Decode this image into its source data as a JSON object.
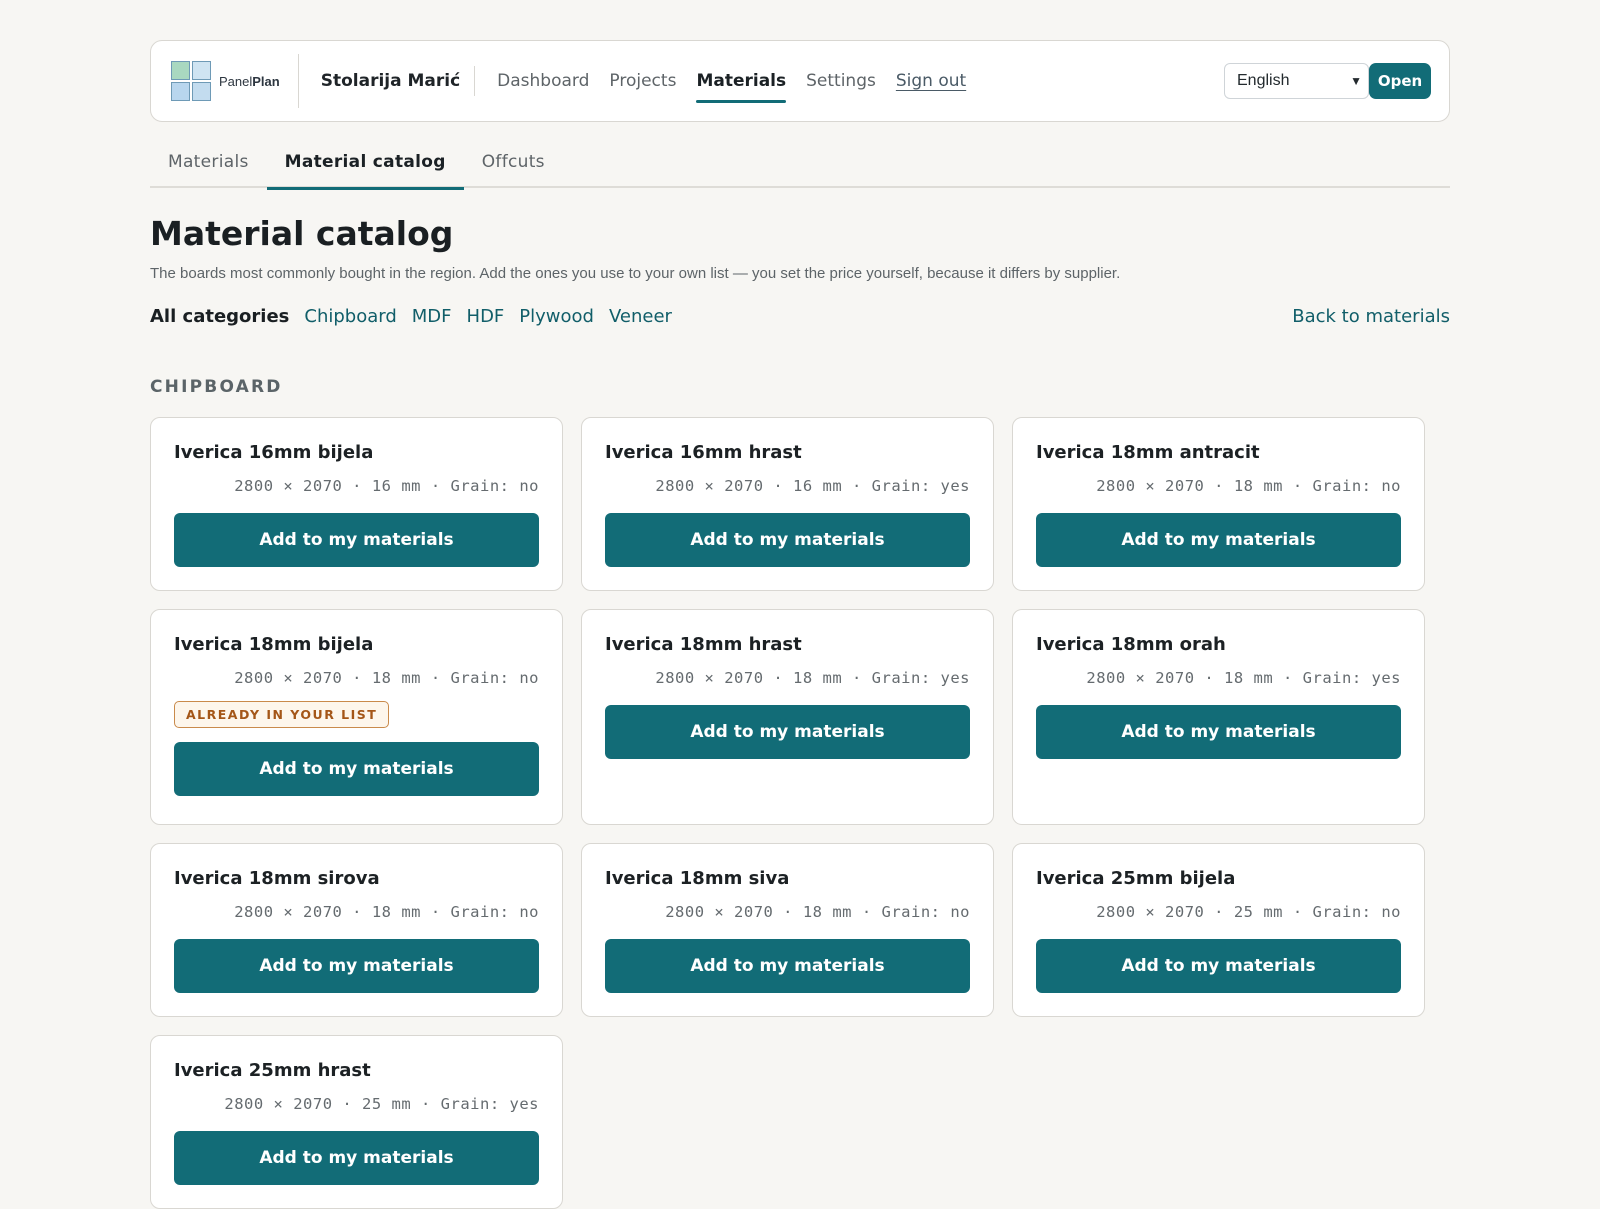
{
  "header": {
    "brand": {
      "part1": "Panel",
      "part2": "Plan"
    },
    "workshop": "Stolarija Marić",
    "nav": [
      {
        "label": "Dashboard",
        "active": false
      },
      {
        "label": "Projects",
        "active": false
      },
      {
        "label": "Materials",
        "active": true
      },
      {
        "label": "Settings",
        "active": false
      },
      {
        "label": "Sign out",
        "active": false
      }
    ],
    "language": "English",
    "open_label": "Open"
  },
  "tabs": [
    {
      "label": "Materials",
      "active": false
    },
    {
      "label": "Material catalog",
      "active": true
    },
    {
      "label": "Offcuts",
      "active": false
    }
  ],
  "page": {
    "title": "Material catalog",
    "subtitle": "The boards most commonly bought in the region. Add the ones you use to your own list — you set the price yourself, because it differs by supplier."
  },
  "filters": {
    "items": [
      "All categories",
      "Chipboard",
      "MDF",
      "HDF",
      "Plywood",
      "Veneer"
    ],
    "active": "All categories",
    "back_label": "Back to materials"
  },
  "section_title": "CHIPBOARD",
  "add_label": "Add to my materials",
  "badge_label": "ALREADY IN YOUR LIST",
  "cards": [
    {
      "name": "Iverica 16mm bijela",
      "spec": "2800 × 2070 · 16 mm · Grain: no",
      "in_list": false
    },
    {
      "name": "Iverica 16mm hrast",
      "spec": "2800 × 2070 · 16 mm · Grain: yes",
      "in_list": false
    },
    {
      "name": "Iverica 18mm antracit",
      "spec": "2800 × 2070 · 18 mm · Grain: no",
      "in_list": false
    },
    {
      "name": "Iverica 18mm bijela",
      "spec": "2800 × 2070 · 18 mm · Grain: no",
      "in_list": true
    },
    {
      "name": "Iverica 18mm hrast",
      "spec": "2800 × 2070 · 18 mm · Grain: yes",
      "in_list": false
    },
    {
      "name": "Iverica 18mm orah",
      "spec": "2800 × 2070 · 18 mm · Grain: yes",
      "in_list": false
    },
    {
      "name": "Iverica 18mm sirova",
      "spec": "2800 × 2070 · 18 mm · Grain: no",
      "in_list": false
    },
    {
      "name": "Iverica 18mm siva",
      "spec": "2800 × 2070 · 18 mm · Grain: no",
      "in_list": false
    },
    {
      "name": "Iverica 25mm bijela",
      "spec": "2800 × 2070 · 25 mm · Grain: no",
      "in_list": false
    },
    {
      "name": "Iverica 25mm hrast",
      "spec": "2800 × 2070 · 25 mm · Grain: yes",
      "in_list": false
    }
  ],
  "colors": {
    "accent": "#126c77",
    "badge_border": "#c98a4b",
    "badge_text": "#a45618"
  }
}
